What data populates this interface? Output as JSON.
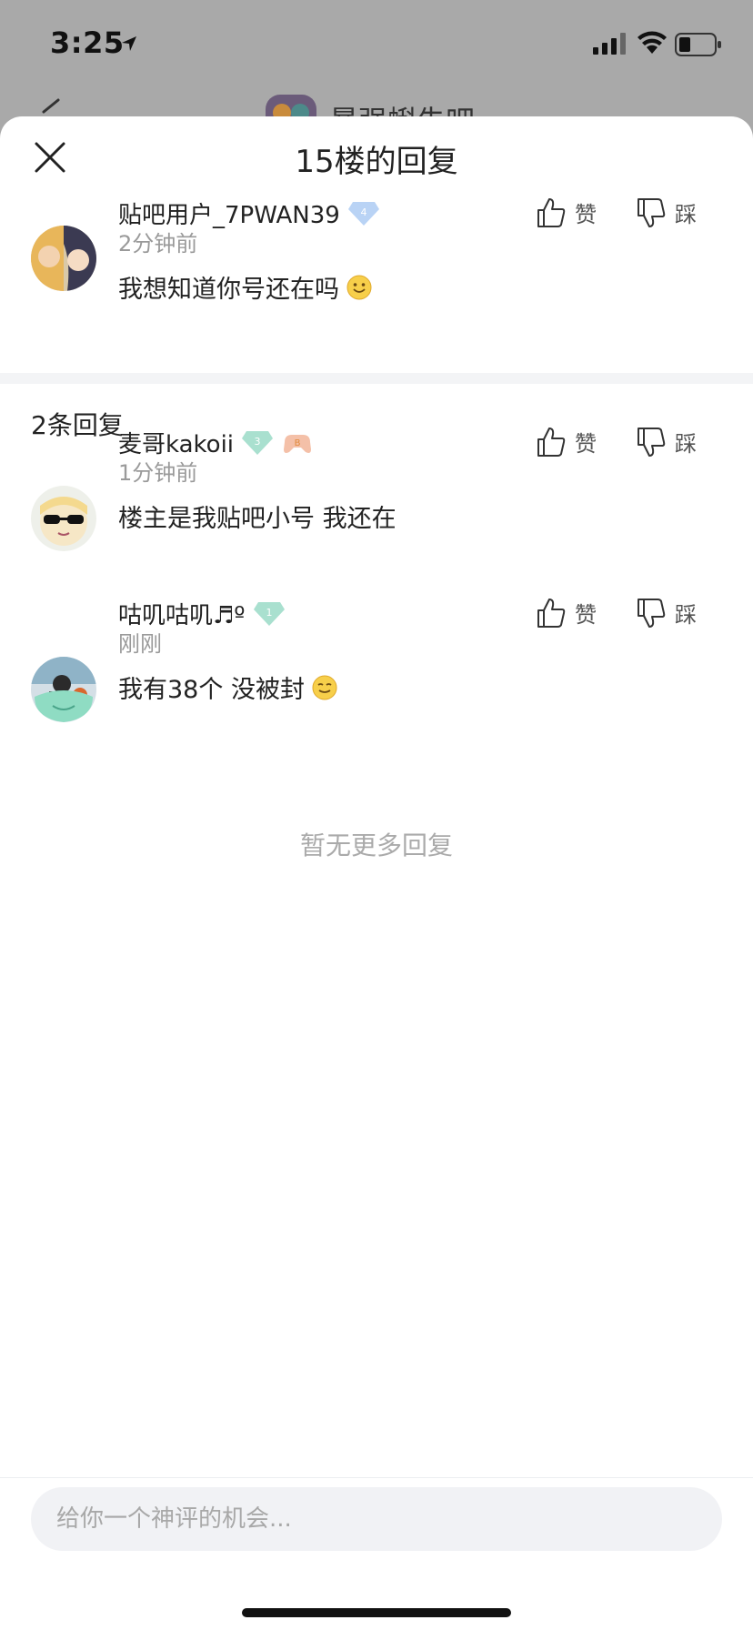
{
  "status_bar": {
    "time": "3:25"
  },
  "background_page": {
    "forum_title": "暴强蝌朱吧"
  },
  "sheet": {
    "title": "15楼的回复"
  },
  "main_comment": {
    "username": "贴吧用户_7PWAN39",
    "level": "4",
    "time": "2分钟前",
    "text": "我想知道你号还在吗",
    "like_label": "赞",
    "dislike_label": "踩"
  },
  "replies_header": "2条回复",
  "replies": [
    {
      "username": "麦哥kakoii",
      "level": "3",
      "extra_badge": "B",
      "time": "1分钟前",
      "text": "楼主是我贴吧小号 我还在",
      "like_label": "赞",
      "dislike_label": "踩"
    },
    {
      "username": "咕叽咕叽♬º",
      "level": "1",
      "time": "刚刚",
      "text": "我有38个 没被封",
      "like_label": "赞",
      "dislike_label": "踩"
    }
  ],
  "no_more_text": "暂无更多回复",
  "input": {
    "placeholder": "给你一个神评的机会..."
  }
}
